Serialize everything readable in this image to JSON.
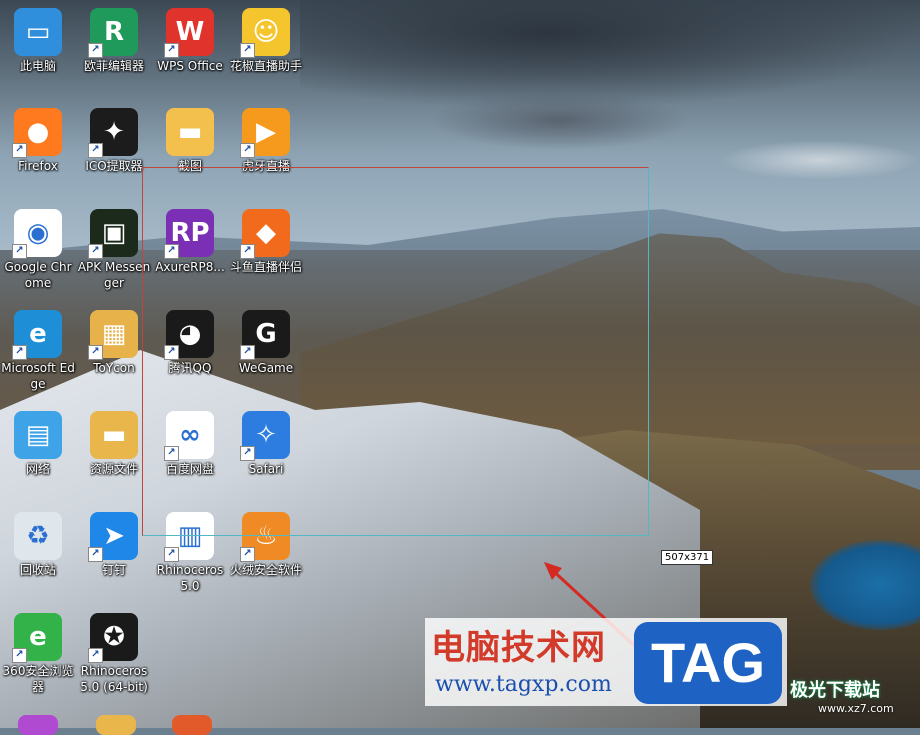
{
  "desktop": {
    "icons": [
      {
        "label": "此电脑",
        "icon": "computer-icon",
        "color": "#2f8fdc",
        "shortcut": false
      },
      {
        "label": "欧菲编辑器",
        "icon": "oufei-editor-icon",
        "color": "#1f9a5a",
        "shortcut": true
      },
      {
        "label": "WPS Office",
        "icon": "wps-icon",
        "color": "#e0332b",
        "shortcut": true
      },
      {
        "label": "花椒直播助手",
        "icon": "huajiao-icon",
        "color": "#f5c52e",
        "shortcut": true
      },
      {
        "label": "Firefox",
        "icon": "firefox-icon",
        "color": "#ff7a1f",
        "shortcut": true
      },
      {
        "label": "ICO提取器",
        "icon": "ico-extractor-icon",
        "color": "#1c1c1c",
        "shortcut": true
      },
      {
        "label": "截图",
        "icon": "folder-icon",
        "color": "#f3c04e",
        "shortcut": false
      },
      {
        "label": "虎牙直播",
        "icon": "huya-icon",
        "color": "#f59a1c",
        "shortcut": true
      },
      {
        "label": "Google Chrome",
        "icon": "chrome-icon",
        "color": "#ffffff",
        "shortcut": true
      },
      {
        "label": "APK Messenger",
        "icon": "apk-messenger-icon",
        "color": "#1b2a1b",
        "shortcut": true
      },
      {
        "label": "AxureRP8...",
        "icon": "axure-icon",
        "color": "#7b2fb5",
        "shortcut": true
      },
      {
        "label": "斗鱼直播伴侣",
        "icon": "douyu-icon",
        "color": "#f26a1b",
        "shortcut": true
      },
      {
        "label": "Microsoft Edge",
        "icon": "edge-icon",
        "color": "#1e8fd6",
        "shortcut": true
      },
      {
        "label": "ToYcon",
        "icon": "toycon-icon",
        "color": "#e7b24a",
        "shortcut": true
      },
      {
        "label": "腾讯QQ",
        "icon": "qq-icon",
        "color": "#1a1a1a",
        "shortcut": true
      },
      {
        "label": "WeGame",
        "icon": "wegame-icon",
        "color": "#1a1a1a",
        "shortcut": true
      },
      {
        "label": "网络",
        "icon": "network-icon",
        "color": "#3fa3e8",
        "shortcut": false
      },
      {
        "label": "资源文件",
        "icon": "folder-icon",
        "color": "#e8b64a",
        "shortcut": false
      },
      {
        "label": "百度网盘",
        "icon": "baidu-netdisk-icon",
        "color": "#ffffff",
        "shortcut": true
      },
      {
        "label": "Safari",
        "icon": "safari-icon",
        "color": "#2d7ce0",
        "shortcut": true
      },
      {
        "label": "回收站",
        "icon": "recycle-bin-icon",
        "color": "#dfe6ec",
        "shortcut": false
      },
      {
        "label": "钉钉",
        "icon": "dingtalk-icon",
        "color": "#1f87e8",
        "shortcut": true
      },
      {
        "label": "Rhinoceros 5.0",
        "icon": "rhino-icon",
        "color": "#ffffff",
        "shortcut": true
      },
      {
        "label": "火绒安全软件",
        "icon": "huorong-icon",
        "color": "#f08a24",
        "shortcut": true
      },
      {
        "label": "360安全浏览器",
        "icon": "360-browser-icon",
        "color": "#33b24a",
        "shortcut": true
      },
      {
        "label": "Rhinoceros 5.0 (64-bit)",
        "icon": "rhino-64-icon",
        "color": "#1a1a1a",
        "shortcut": true
      }
    ]
  },
  "selection": {
    "size_readout": "507x371"
  },
  "watermark": {
    "title": "电脑技术网",
    "url": "www.tagxp.com",
    "logo": "TAG",
    "site2": "极光下载站",
    "site2_url": "www.xz7.com"
  }
}
